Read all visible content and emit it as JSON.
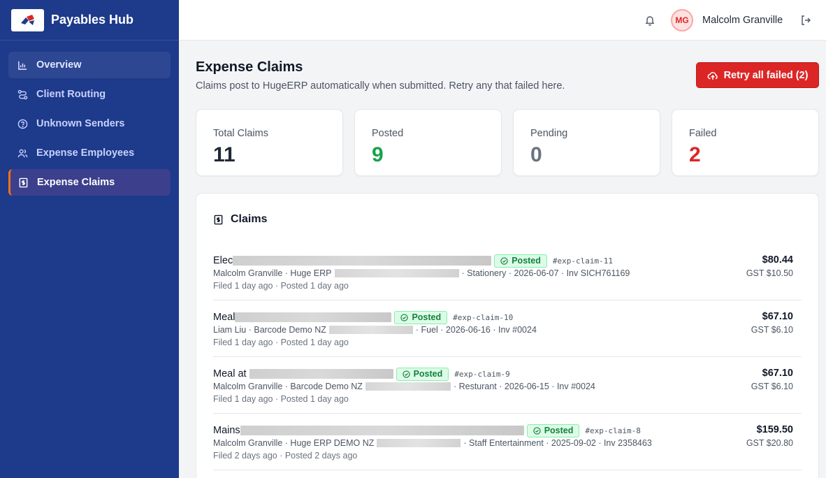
{
  "brand": {
    "name": "Payables Hub"
  },
  "sidebar": {
    "items": [
      {
        "label": "Overview",
        "icon": "bar-chart-icon"
      },
      {
        "label": "Client Routing",
        "icon": "route-icon"
      },
      {
        "label": "Unknown Senders",
        "icon": "question-circle-icon"
      },
      {
        "label": "Expense Employees",
        "icon": "users-icon"
      },
      {
        "label": "Expense Claims",
        "icon": "receipt-icon",
        "active": true
      }
    ]
  },
  "header": {
    "user_initials": "MG",
    "user_name": "Malcolm Granville"
  },
  "main": {
    "title": "Expense Claims",
    "subtitle": "Claims post to HugeERP automatically when submitted. Retry any that failed here.",
    "retry_label": "Retry all failed (2)"
  },
  "stats": [
    {
      "label": "Total Claims",
      "value": "11",
      "color": "#1f2937"
    },
    {
      "label": "Posted",
      "value": "9",
      "color": "#16a34a"
    },
    {
      "label": "Pending",
      "value": "0",
      "color": "#6b7280"
    },
    {
      "label": "Failed",
      "value": "2",
      "color": "#dc2626"
    }
  ],
  "claims_card": {
    "title": "Claims"
  },
  "claims": [
    {
      "title": "Elec",
      "status": "Posted",
      "tag": "#exp-claim-11",
      "person": "Malcolm Granville · Huge ERP",
      "details": "· Stationery · 2026-06-07 · Inv SICH761169",
      "filed": "Filed 1 day ago · Posted 1 day ago",
      "amount": "$80.44",
      "gst": "GST $10.50"
    },
    {
      "title": "Meal",
      "status": "Posted",
      "tag": "#exp-claim-10",
      "person": "Liam Liu · Barcode Demo NZ",
      "details": "· Fuel · 2026-06-16 · Inv #0024",
      "filed": "Filed 1 day ago · Posted 1 day ago",
      "amount": "$67.10",
      "gst": "GST $6.10"
    },
    {
      "title": "Meal at",
      "status": "Posted",
      "tag": "#exp-claim-9",
      "person": "Malcolm Granville · Barcode Demo NZ",
      "details": "· Resturant · 2026-06-15 · Inv #0024",
      "filed": "Filed 1 day ago · Posted 1 day ago",
      "amount": "$67.10",
      "gst": "GST $6.10"
    },
    {
      "title": "Mains",
      "status": "Posted",
      "tag": "#exp-claim-8",
      "person": "Malcolm Granville · Huge ERP DEMO NZ",
      "details": "· Staff Entertainment · 2025-09-02 · Inv 2358463",
      "filed": "Filed 2 days ago · Posted 2 days ago",
      "amount": "$159.50",
      "gst": "GST $20.80"
    }
  ],
  "colors": {
    "sidebar": "#1e3a8a",
    "danger": "#dc2626",
    "success": "#16a34a"
  }
}
